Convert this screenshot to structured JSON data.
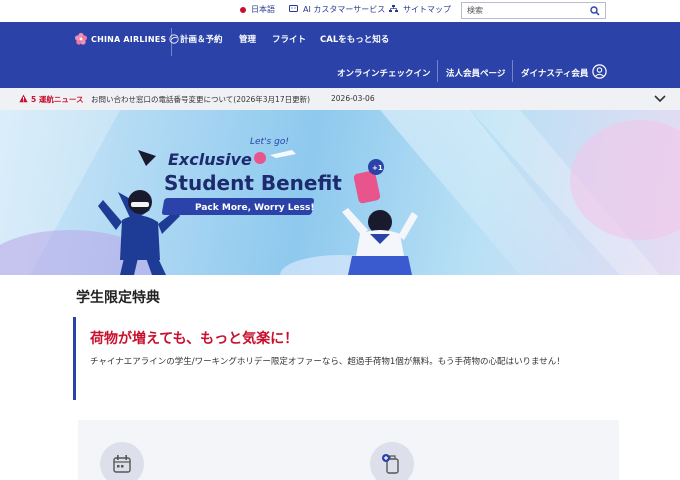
{
  "utility": {
    "lang_label": "日本語",
    "ai_label": "AI カスタマーサービス",
    "sitemap_label": "サイトマップ",
    "search_placeholder": "検索"
  },
  "nav": {
    "brand": "CHINA AIRLINES",
    "row1": [
      "計画＆予約",
      "管理",
      "フライト",
      "CALをもっと知る"
    ],
    "row2": [
      "オンラインチェックイン",
      "法人会員ページ",
      "ダイナスティ会員"
    ]
  },
  "alert": {
    "count": "5 運航ニュース",
    "message": "お問い合わせ窓口の電話番号変更について(2026年3月17日更新)",
    "date": "2026-03-06"
  },
  "hero": {
    "tagline": "Let's go!",
    "title_line1": "Exclusive",
    "title_line2": "Student Benefit",
    "subtitle": "Pack More, Worry Less!",
    "badge": "+1"
  },
  "page": {
    "title": "学生限定特典",
    "callout_title": "荷物が増えても、もっと気楽に！",
    "callout_text": "チャイナエアラインの学生/ワーキングホリデー限定オファーなら、超過手荷物1個が無料。もう手荷物の心配はいりません！"
  },
  "colors": {
    "brand_blue": "#2b43a8",
    "accent_red": "#c8102e"
  },
  "icons": [
    "globe-dot-icon",
    "ai-chat-icon",
    "sitemap-icon",
    "search-icon",
    "plum-blossom-logo-icon",
    "user-icon",
    "warning-icon",
    "chevron-down-icon",
    "calendar-icon",
    "luggage-plus-icon"
  ]
}
